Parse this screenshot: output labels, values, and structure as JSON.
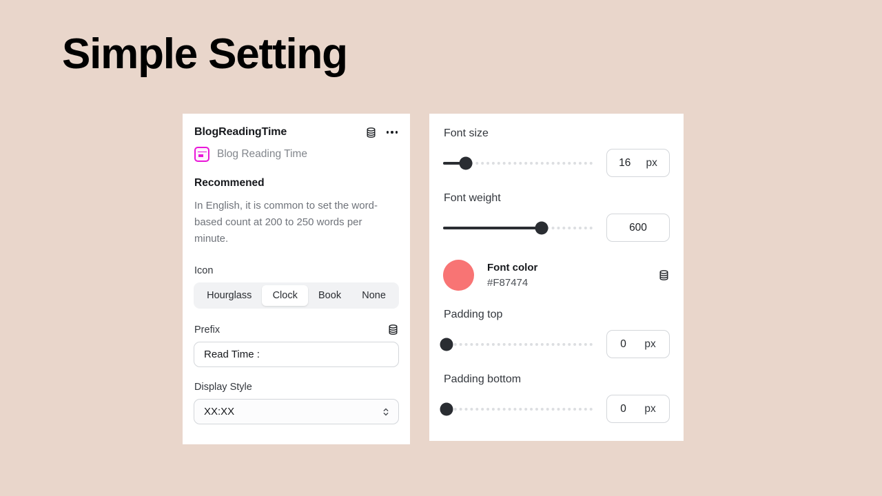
{
  "page": {
    "title": "Simple Setting",
    "background_color": "#E9D6CB"
  },
  "left_panel": {
    "title": "BlogReadingTime",
    "db_icon": "database-icon",
    "more_icon": "ellipsis-icon",
    "badge_icon": "card-widget-icon",
    "subtitle": "Blog Reading Time",
    "recommended_heading": "Recommened",
    "recommended_body": "In English, it is common to set the word-based count at 200 to 250 words per minute.",
    "icon_field": {
      "label": "Icon",
      "options": [
        "Hourglass",
        "Clock",
        "Book",
        "None"
      ],
      "selected": "Clock"
    },
    "prefix_field": {
      "label": "Prefix",
      "db_icon": "database-icon",
      "value": "Read Time :",
      "placeholder": "Read Time :"
    },
    "display_style_field": {
      "label": "Display Style",
      "value": "XX:XX",
      "chevron_icon": "chevron-up-down-icon"
    }
  },
  "right_panel": {
    "font_size": {
      "label": "Font size",
      "value": "16",
      "unit": "px",
      "fill_percent": 15
    },
    "font_weight": {
      "label": "Font weight",
      "value": "600",
      "unit": "",
      "fill_percent": 66
    },
    "font_color": {
      "label": "Font color",
      "hex": "#F87474",
      "swatch_color": "#F87474",
      "db_icon": "database-icon"
    },
    "padding_top": {
      "label": "Padding top",
      "value": "0",
      "unit": "px",
      "fill_percent": 0
    },
    "padding_bottom": {
      "label": "Padding bottom",
      "value": "0",
      "unit": "px",
      "fill_percent": 0
    }
  }
}
